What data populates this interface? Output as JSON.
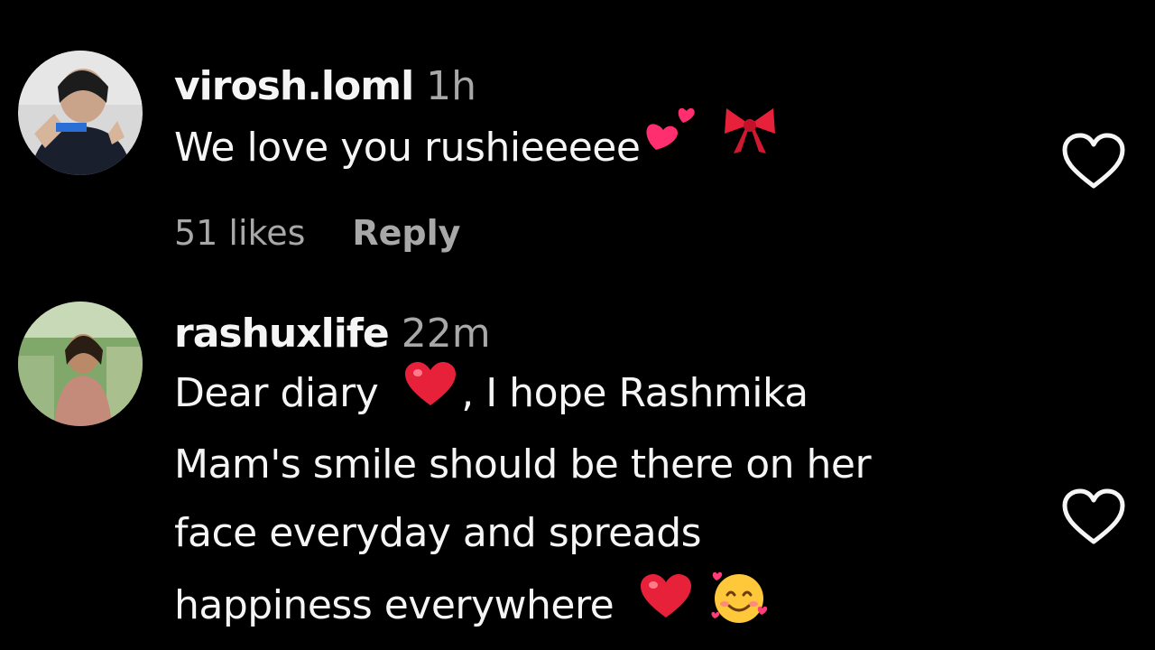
{
  "comments": [
    {
      "username": "virosh.loml",
      "time": "1h",
      "text_lines": [
        "We love you rushieeeee"
      ],
      "emojis": [
        "two-hearts-emoji",
        "ribbon-emoji"
      ],
      "likes": "51 likes",
      "reply_label": "Reply"
    },
    {
      "username": "rashuxlife",
      "time": "22m",
      "text_lines": [
        "Dear diary",
        ", I hope Rashmika",
        "Mam's smile should be there on her",
        "face everyday and spreads",
        "happiness everywhere"
      ],
      "emojis": [
        "red-heart-emoji",
        "red-heart-emoji",
        "smiling-face-with-hearts-emoji"
      ]
    }
  ],
  "colors": {
    "background": "#000000",
    "primary_text": "#f5f5f5",
    "secondary_text": "#a8a8a8",
    "heart_red": "#e8213a",
    "pink": "#ff3b7a"
  },
  "icons": [
    "heart-outline-icon",
    "avatar-photo"
  ]
}
